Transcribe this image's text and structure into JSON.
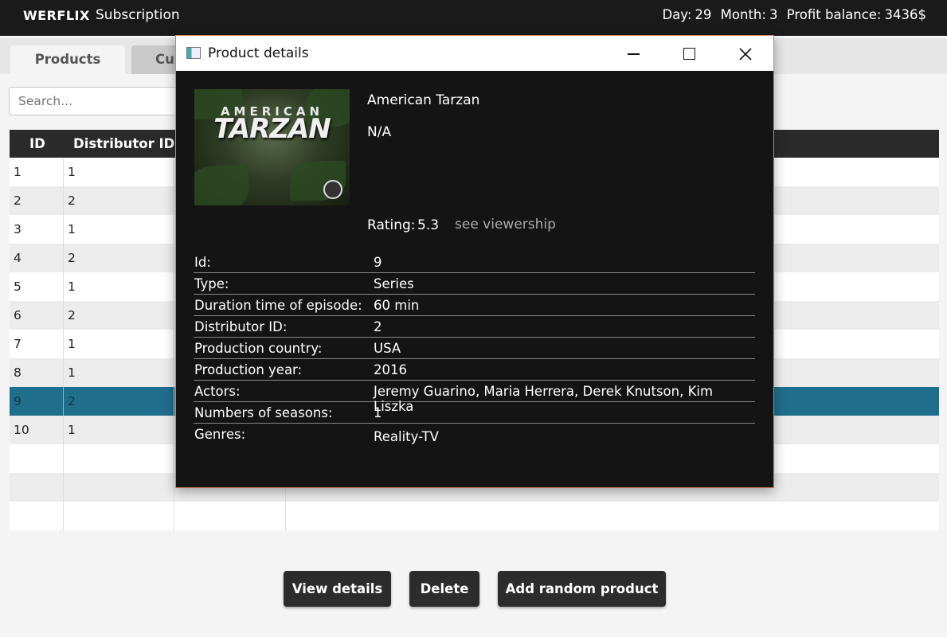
{
  "app": {
    "brand": "WERFLIX",
    "menu": "Subscription",
    "day_label": "Day:",
    "day": "29",
    "month_label": "Month:",
    "month": "3",
    "profit_label": "Profit balance:",
    "profit": "3436$"
  },
  "tabs": {
    "products": "Products",
    "customers_partial": "Cus"
  },
  "search": {
    "placeholder": "Search..."
  },
  "table": {
    "headers": {
      "id": "ID",
      "distributor": "Distributor ID"
    },
    "rows": [
      {
        "id": "1",
        "dist": "1"
      },
      {
        "id": "2",
        "dist": "2"
      },
      {
        "id": "3",
        "dist": "1"
      },
      {
        "id": "4",
        "dist": "2"
      },
      {
        "id": "5",
        "dist": "1"
      },
      {
        "id": "6",
        "dist": "2"
      },
      {
        "id": "7",
        "dist": "1"
      },
      {
        "id": "8",
        "dist": "1"
      },
      {
        "id": "9",
        "dist": "2"
      },
      {
        "id": "10",
        "dist": "1"
      }
    ],
    "selected_row_color": "#1f6e8c"
  },
  "buttons": {
    "view": "View details",
    "delete": "Delete",
    "add": "Add random product"
  },
  "dialog": {
    "title": "Product details",
    "poster": {
      "line1": "AMERICAN",
      "line2": "TARZAN"
    },
    "name": "American Tarzan",
    "subtitle": "N/A",
    "rating_label": "Rating:",
    "rating": "5.3",
    "viewership_link": "see viewership",
    "props": [
      {
        "k": "Id:",
        "v": "9"
      },
      {
        "k": "Type:",
        "v": "Series"
      },
      {
        "k": "Duration time of episode:",
        "v": "60 min"
      },
      {
        "k": "Distributor ID:",
        "v": "2"
      },
      {
        "k": "Production country:",
        "v": "USA"
      },
      {
        "k": "Production year:",
        "v": "2016"
      },
      {
        "k": "Actors:",
        "v": "Jeremy Guarino, Maria Herrera, Derek Knutson, Kim Liszka"
      },
      {
        "k": "Numbers of seasons:",
        "v": "1"
      },
      {
        "k": "Genres:",
        "v": "Reality-TV"
      }
    ],
    "icons": {
      "minimize": "minimize-icon",
      "maximize": "maximize-icon",
      "close": "close-icon"
    }
  }
}
